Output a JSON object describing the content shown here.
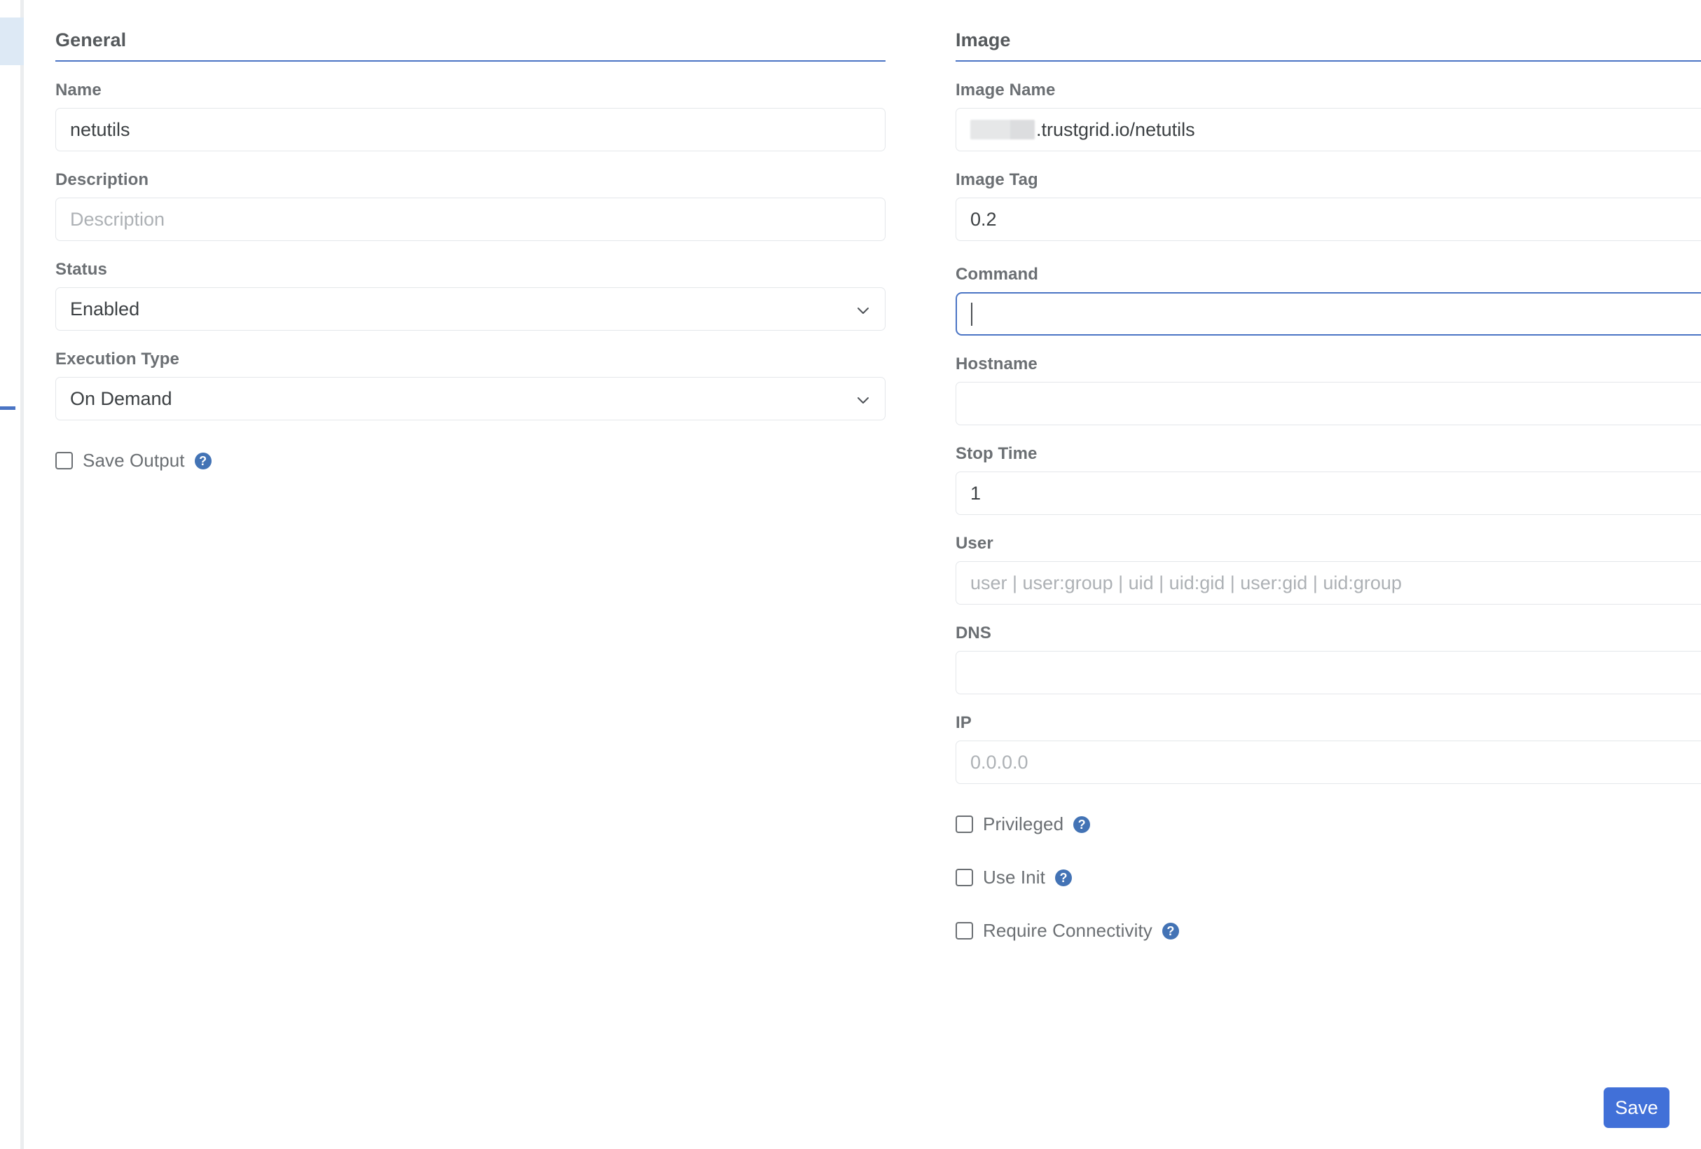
{
  "general": {
    "title": "General",
    "name": {
      "label": "Name",
      "value": "netutils"
    },
    "description": {
      "label": "Description",
      "value": "",
      "placeholder": "Description"
    },
    "status": {
      "label": "Status",
      "value": "Enabled"
    },
    "execution_type": {
      "label": "Execution Type",
      "value": "On Demand"
    },
    "save_output": {
      "label": "Save Output",
      "checked": false,
      "help": "?"
    }
  },
  "image": {
    "title": "Image",
    "image_name": {
      "label": "Image Name",
      "value": ".trustgrid.io/netutils",
      "refresh": "refresh-icon"
    },
    "image_tag": {
      "label": "Image Tag",
      "value": "0.2",
      "refresh": "refresh-icon"
    },
    "command": {
      "label": "Command",
      "value": "",
      "help": "?"
    },
    "hostname": {
      "label": "Hostname",
      "value": "",
      "help": "?"
    },
    "stop_time": {
      "label": "Stop Time",
      "value": "1",
      "help": "?"
    },
    "user": {
      "label": "User",
      "value": "",
      "placeholder": "user | user:group | uid | uid:gid | user:gid | uid:group",
      "help": "?"
    },
    "dns": {
      "label": "DNS",
      "value": "",
      "help": "?"
    },
    "ip": {
      "label": "IP",
      "value": "",
      "placeholder": "0.0.0.0",
      "help": "?"
    },
    "privileged": {
      "label": "Privileged",
      "checked": false,
      "help": "?"
    },
    "use_init": {
      "label": "Use Init",
      "checked": false,
      "help": "?"
    },
    "require_connectivity": {
      "label": "Require Connectivity",
      "checked": false,
      "help": "?"
    }
  },
  "footer": {
    "save_label": "Save"
  },
  "colors": {
    "accent": "#4a74c4",
    "save_button": "#4170d8",
    "help_badge": "#4373b5",
    "rail_active": "#dde9f5",
    "label_text": "#6b6f73",
    "border": "#e4e7ea"
  }
}
